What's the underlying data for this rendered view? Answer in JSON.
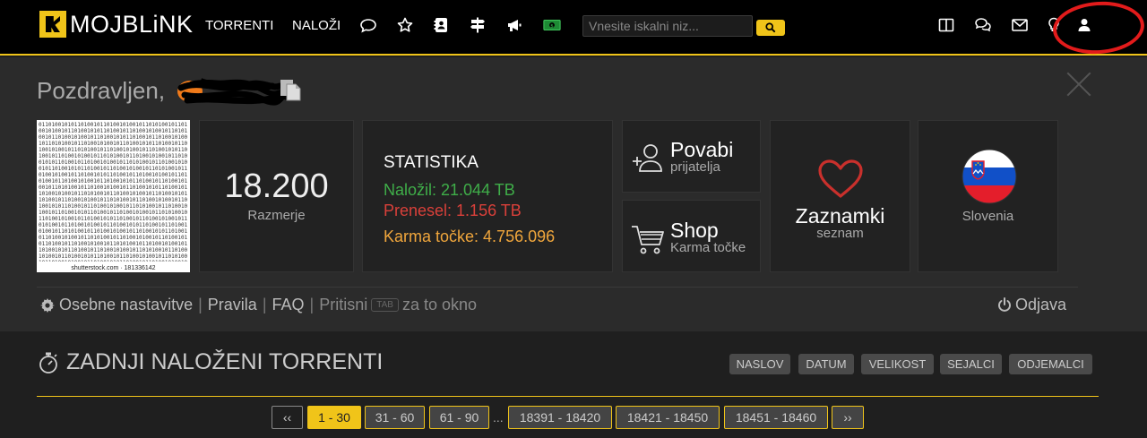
{
  "brand": {
    "name": "MOJBLiNK",
    "accent": "#f0c419"
  },
  "nav": {
    "links": [
      "TORRENTI",
      "NALOŽI"
    ],
    "icons": [
      "chat-bubble-icon",
      "star-icon",
      "id-card-icon",
      "signpost-icon",
      "megaphone-icon",
      "money-icon"
    ],
    "search_placeholder": "Vnesite iskalni niz...",
    "right_icons": [
      "columns-icon",
      "chat-icon",
      "mail-icon",
      "lightbulb-icon",
      "user-icon"
    ]
  },
  "profile": {
    "greeting": "Pozdravljen,",
    "avatar_caption": "shutterstock.com · 181336142",
    "ratio": {
      "value": "18.200",
      "label": "Razmerje"
    },
    "stats": {
      "title": "STATISTIKA",
      "uploaded": "Naložil: 21.044 TB",
      "downloaded": "Prenesel: 1.156 TB",
      "karma": "Karma točke: 4.756.096",
      "uploaded_color": "#3fae49",
      "downloaded_color": "#d9403a",
      "karma_color": "#f0a63c"
    },
    "invite": {
      "title": "Povabi",
      "sub": "prijatelja"
    },
    "shop": {
      "title": "Shop",
      "sub": "Karma točke"
    },
    "bookmarks": {
      "title": "Zaznamki",
      "sub": "seznam"
    },
    "country": {
      "name": "Slovenia"
    },
    "links": {
      "settings": "Osebne nastavitve",
      "rules": "Pravila",
      "faq": "FAQ",
      "press": "Pritisni",
      "tab_key": "TAB",
      "window": "za to okno",
      "logout": "Odjava"
    }
  },
  "section": {
    "title": "ZADNJI NALOŽENI TORRENTI",
    "sort_buttons": [
      "NASLOV",
      "DATUM",
      "VELIKOST",
      "SEJALCI",
      "ODJEMALCI"
    ]
  },
  "pagination": {
    "prev": "‹‹",
    "pages": [
      "1 - 30",
      "31 - 60",
      "61 - 90",
      "18391 - 18420",
      "18421 - 18450",
      "18451 - 18460"
    ],
    "ellipsis": "...",
    "next": "››",
    "active_index": 0
  }
}
